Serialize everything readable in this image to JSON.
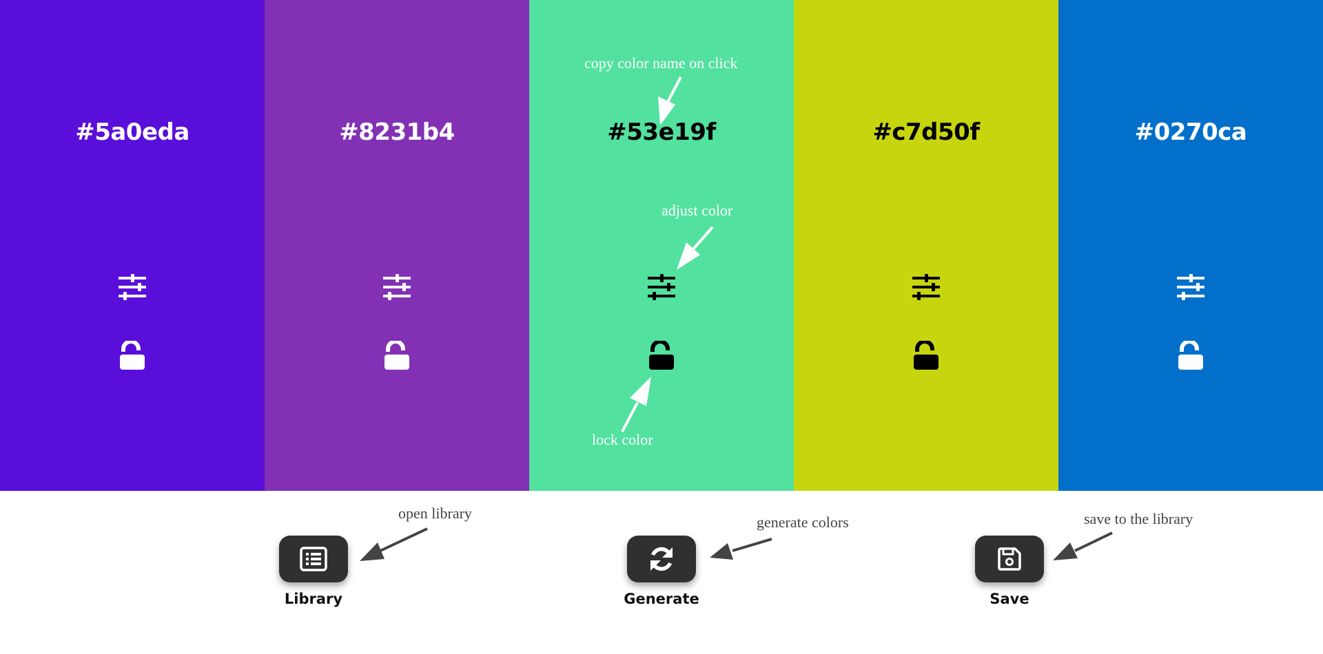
{
  "swatches": [
    {
      "hex": "#5a0eda",
      "bg": "#5a0eda",
      "fg": "#ffffff"
    },
    {
      "hex": "#8231b4",
      "bg": "#8231b4",
      "fg": "#ffffff"
    },
    {
      "hex": "#53e19f",
      "bg": "#53e19f",
      "fg": "#000000"
    },
    {
      "hex": "#c7d50f",
      "bg": "#c7d50f",
      "fg": "#000000"
    },
    {
      "hex": "#0270ca",
      "bg": "#0270ca",
      "fg": "#ffffff"
    }
  ],
  "annotations": {
    "copy": "copy color name on click",
    "adjust": "adjust color",
    "lock": "lock color",
    "library": "open library",
    "generate": "generate colors",
    "save": "save to the library"
  },
  "panel": {
    "library_label": "Library",
    "generate_label": "Generate",
    "save_label": "Save"
  },
  "icons": {
    "adjust": "sliders-icon",
    "lock": "unlocked-padlock-icon",
    "library": "list-icon",
    "generate": "refresh-icon",
    "save": "floppy-disk-icon"
  },
  "colors": {
    "panel_button": "#303030",
    "annotation_dark": "#444444"
  }
}
